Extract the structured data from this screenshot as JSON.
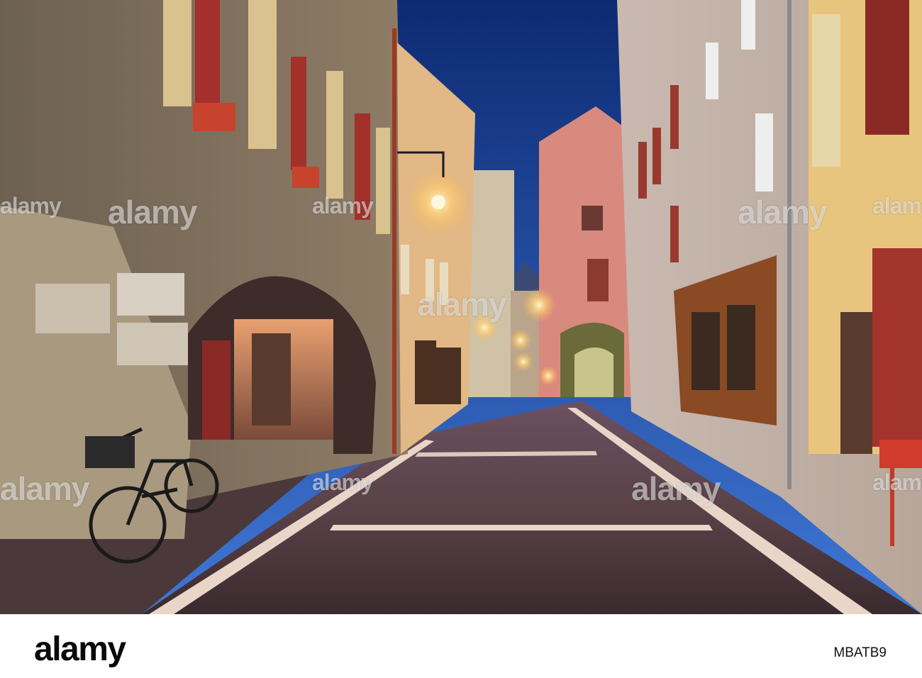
{
  "photo": {
    "description_alt": "Narrow cobblestone street at dusk with arcades, bicycle and lit lanterns",
    "colors": {
      "sky": "#1d4fa8",
      "sky_top": "#0e2d78",
      "stone": "#7a6a5a",
      "lamp": "#ffd27a",
      "pink_house": "#d98a7e"
    }
  },
  "watermarks": {
    "label": "alamy"
  },
  "footer": {
    "logo": "alamy",
    "image_id": "MBATB9"
  }
}
